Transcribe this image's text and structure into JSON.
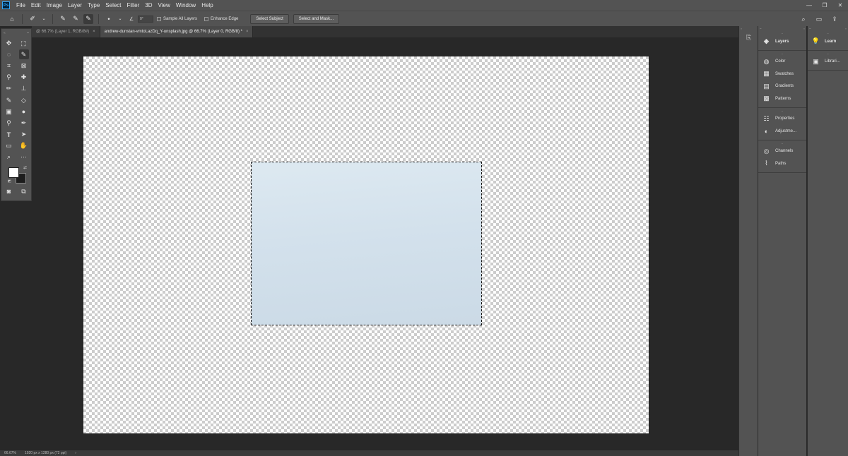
{
  "menubar": {
    "logo": "Ps",
    "items": [
      "File",
      "Edit",
      "Image",
      "Layer",
      "Type",
      "Select",
      "Filter",
      "3D",
      "View",
      "Window",
      "Help"
    ],
    "window_controls": [
      "—",
      "❐",
      "✕"
    ]
  },
  "options": {
    "angle_value": "0°",
    "sample_all_layers": "Sample All Layers",
    "enhance_edge": "Enhance Edge",
    "select_subject": "Select Subject",
    "select_and_mask": "Select and Mask..."
  },
  "tabs": [
    {
      "label": "@ 66.7% (Layer 1, RGB/8#)",
      "close": "×",
      "active": false
    },
    {
      "label": "andrew-dunstan-vmtoLazDq_Y-unsplash.jpg @ 66.7% (Layer 0, RGB/8) *",
      "close": "×",
      "active": true
    }
  ],
  "status": {
    "zoom": "66.67%",
    "doc_size": "1920 px x 1280 px (72 ppi)",
    "arrow": "›"
  },
  "panels": {
    "col1_groups": [
      [
        {
          "label": "Layers",
          "icon": "layers-icon",
          "glyph": "◈",
          "bold": true
        }
      ],
      [
        {
          "label": "Color",
          "icon": "color-icon",
          "glyph": "◍",
          "bold": false
        },
        {
          "label": "Swatches",
          "icon": "swatches-icon",
          "glyph": "▦",
          "bold": false
        },
        {
          "label": "Gradients",
          "icon": "gradients-icon",
          "glyph": "▤",
          "bold": false
        },
        {
          "label": "Patterns",
          "icon": "patterns-icon",
          "glyph": "▩",
          "bold": false
        }
      ],
      [
        {
          "label": "Properties",
          "icon": "properties-icon",
          "glyph": "☷",
          "bold": false
        },
        {
          "label": "Adjustme...",
          "icon": "adjustments-icon",
          "glyph": "◐",
          "bold": false
        }
      ],
      [
        {
          "label": "Channels",
          "icon": "channels-icon",
          "glyph": "◎",
          "bold": false
        },
        {
          "label": "Paths",
          "icon": "paths-icon",
          "glyph": "⌇",
          "bold": false
        }
      ]
    ],
    "col2_groups": [
      [
        {
          "label": "Learn",
          "icon": "learn-icon",
          "glyph": "💡",
          "bold": true
        }
      ],
      [
        {
          "label": "Librari...",
          "icon": "libraries-icon",
          "glyph": "▣",
          "bold": false
        }
      ]
    ]
  }
}
